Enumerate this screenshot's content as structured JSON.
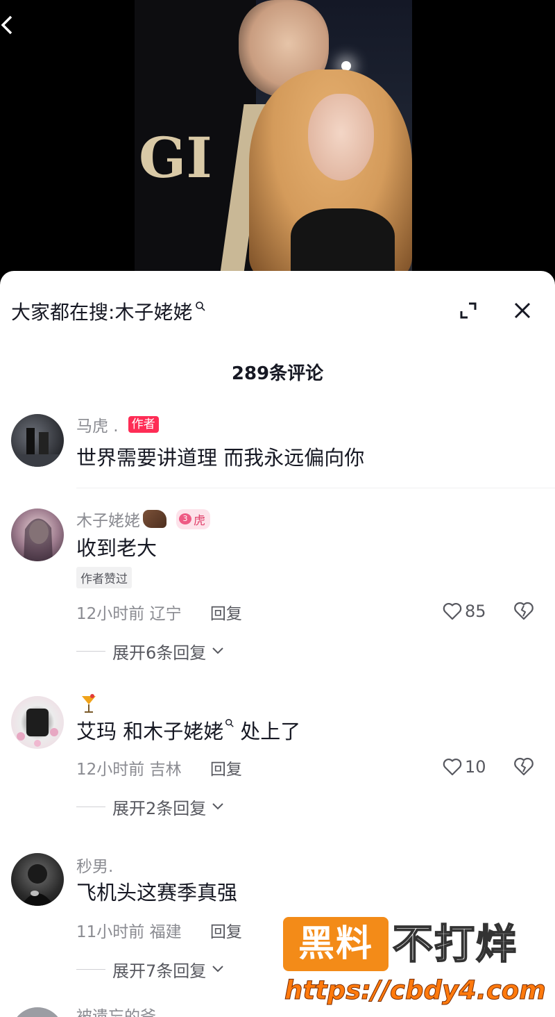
{
  "search": {
    "prefix": "大家都在搜:",
    "term": "木子姥姥"
  },
  "comment_count": "289条评论",
  "comments": [
    {
      "name": "马虎 .",
      "badge": "作者",
      "text": "世界需要讲道理 而我永远偏向你"
    },
    {
      "name": "木子姥姥",
      "fan_badge": "虎",
      "fan_level": "3",
      "text": "收到老大",
      "liked_tag": "作者赞过",
      "time": "12小时前",
      "region": "辽宁",
      "reply": "回复",
      "likes": "85",
      "expand": "展开6条回复"
    },
    {
      "name": "",
      "text_a": "艾玛 和木子姥姥",
      "text_b": "处上了",
      "time": "12小时前",
      "region": "吉林",
      "reply": "回复",
      "likes": "10",
      "expand": "展开2条回复"
    },
    {
      "name": "秒男.",
      "text": "飞机头这赛季真强",
      "time": "11小时前",
      "region": "福建",
      "reply": "回复",
      "expand": "展开7条回复"
    },
    {
      "name": "被遗忘的爷"
    }
  ],
  "watermark": {
    "box": "黑料",
    "text": "不打烊",
    "url": "https://cbdy4.com"
  },
  "colors": {
    "author_tag": "#fe2c55",
    "text_primary": "#161823",
    "text_secondary": "#8a8b91",
    "watermark_orange": "#f38b18"
  }
}
